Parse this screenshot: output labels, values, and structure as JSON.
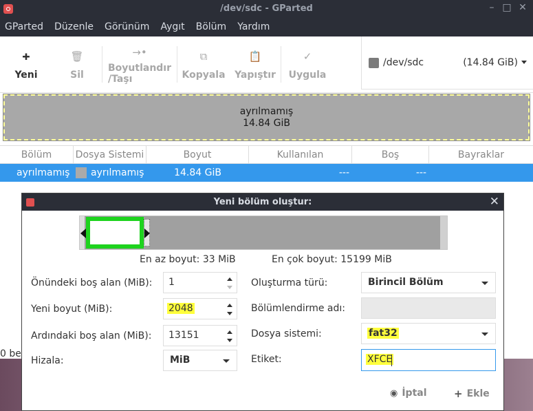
{
  "window": {
    "title": "/dev/sdc - GParted"
  },
  "menu": [
    "GParted",
    "Düzenle",
    "Görünüm",
    "Aygıt",
    "Bölüm",
    "Yardım"
  ],
  "toolbar": {
    "new": "Yeni",
    "delete": "Sil",
    "resize_line1": "Boyutlandır",
    "resize_line2": "/Taşı",
    "copy": "Kopyala",
    "paste": "Yapıştır",
    "apply": "Uygula"
  },
  "device": {
    "name": "/dev/sdc",
    "size": "(14.84 GiB)"
  },
  "diskmap": {
    "label": "ayrılmamış",
    "size": "14.84 GiB"
  },
  "table": {
    "headers": [
      "Bölüm",
      "Dosya Sistemi",
      "Boyut",
      "Kullanılan",
      "Boş",
      "Bayraklar"
    ],
    "rows": [
      {
        "partition": "ayrılmamış",
        "filesystem": "ayrılmamış",
        "size": "14.84 GiB",
        "used": "---",
        "free": "---",
        "flags": ""
      }
    ]
  },
  "status_fragment": "0 be",
  "dialog": {
    "title": "Yeni bölüm oluştur:",
    "min_size": "En az boyut: 33 MiB",
    "max_size": "En çok boyut: 15199 MiB",
    "free_before_label": "Önündeki boş alan (MiB):",
    "free_before_value": "1",
    "new_size_label": "Yeni boyut (MiB):",
    "new_size_value": "2048",
    "free_after_label": "Ardındaki boş alan (MiB):",
    "free_after_value": "13151",
    "align_label": "Hizala:",
    "align_value": "MiB",
    "create_as_label": "Oluşturma türü:",
    "create_as_value": "Birincil Bölüm",
    "partition_name_label": "Bölümlendirme adı:",
    "partition_name_value": "",
    "filesystem_label": "Dosya sistemi:",
    "filesystem_value": "fat32",
    "label_label": "Etiket:",
    "label_value": "XFCE",
    "cancel": "İptal",
    "add": "Ekle"
  }
}
